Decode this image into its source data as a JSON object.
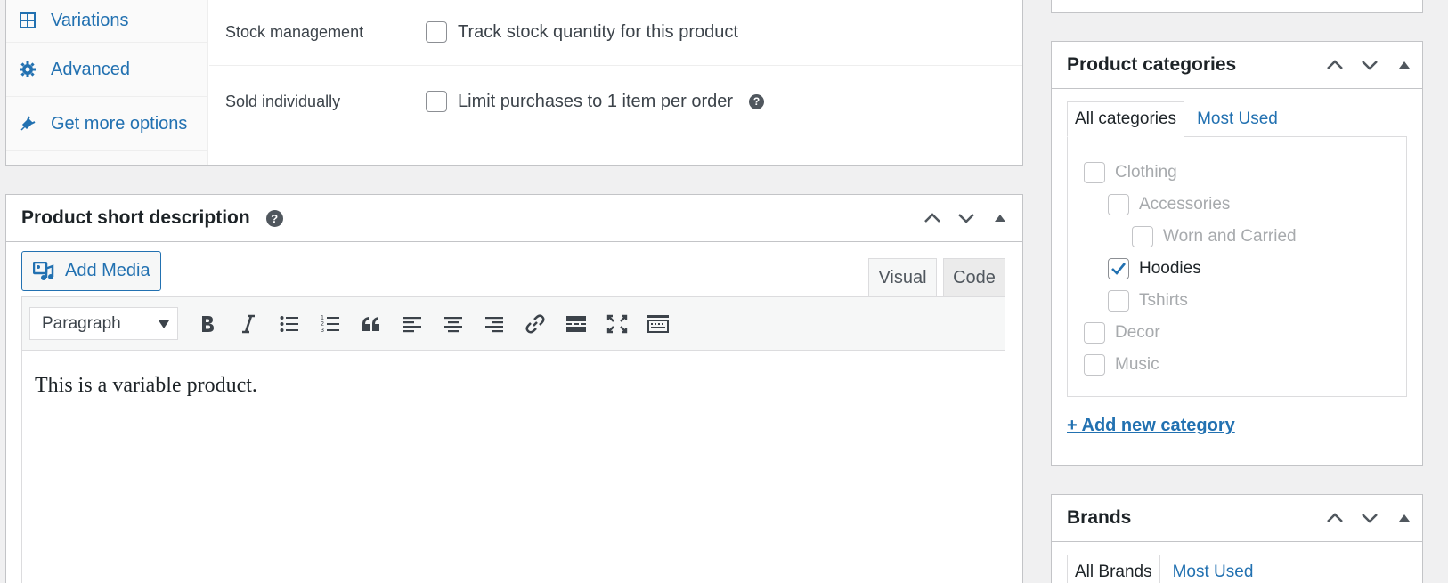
{
  "product_data": {
    "tabs": [
      {
        "label": "Variations",
        "icon": "grid-icon"
      },
      {
        "label": "Advanced",
        "icon": "gear-icon"
      },
      {
        "label": "Get more options",
        "icon": "plugin-icon"
      }
    ],
    "rows": [
      {
        "label": "Stock management",
        "option": "Track stock quantity for this product",
        "checked": false,
        "help": false
      },
      {
        "label": "Sold individually",
        "option": "Limit purchases to 1 item per order",
        "checked": false,
        "help": true
      }
    ],
    "help_glyph": "?"
  },
  "short_description": {
    "title": "Product short description",
    "help_glyph": "?",
    "add_media_label": "Add Media",
    "tabs": {
      "visual": "Visual",
      "code": "Code"
    },
    "format_select": "Paragraph",
    "toolbar_icons": [
      "bold-icon",
      "italic-icon",
      "bullet-list-icon",
      "numbered-list-icon",
      "blockquote-icon",
      "align-left-icon",
      "align-center-icon",
      "align-right-icon",
      "link-icon",
      "read-more-icon",
      "fullscreen-icon",
      "toolbar-toggle-icon"
    ],
    "content": "This is a variable product."
  },
  "categories": {
    "title": "Product categories",
    "tabs": {
      "all": "All categories",
      "most_used": "Most Used"
    },
    "items": [
      {
        "label": "Clothing",
        "level": 0,
        "checked": false
      },
      {
        "label": "Accessories",
        "level": 1,
        "checked": false
      },
      {
        "label": "Worn and Carried",
        "level": 2,
        "checked": false
      },
      {
        "label": "Hoodies",
        "level": 1,
        "checked": true
      },
      {
        "label": "Tshirts",
        "level": 1,
        "checked": false
      },
      {
        "label": "Decor",
        "level": 0,
        "checked": false
      },
      {
        "label": "Music",
        "level": 0,
        "checked": false
      }
    ],
    "add_new": "+ Add new category"
  },
  "brands": {
    "title": "Brands",
    "tabs": {
      "all": "All Brands",
      "most_used": "Most Used"
    }
  },
  "colors": {
    "link": "#2271b1",
    "border": "#c3c4c7",
    "background": "#f0f0f1"
  }
}
